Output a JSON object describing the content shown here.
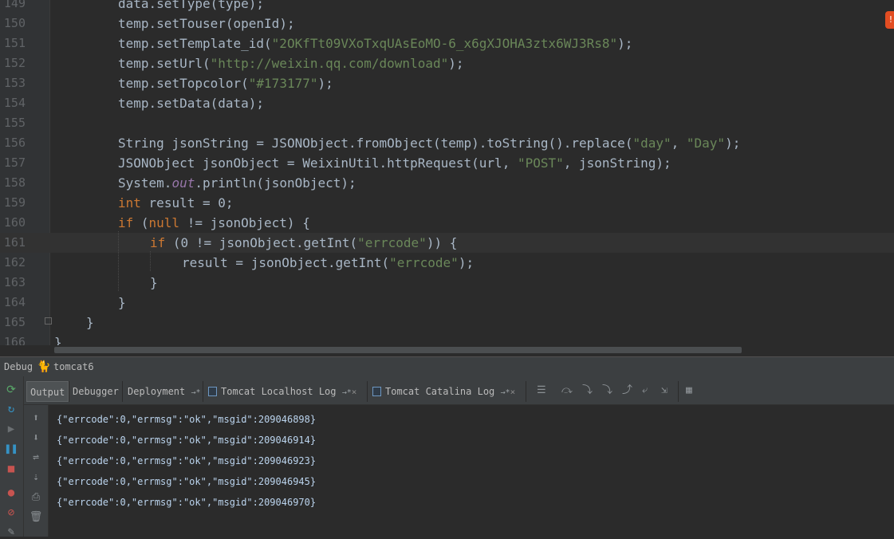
{
  "editor": {
    "lines": [
      {
        "num": "149",
        "indent": 2,
        "tokens": [
          [
            "v",
            "data"
          ],
          [
            "p",
            "."
          ],
          [
            "m",
            "setType"
          ],
          [
            "p",
            "("
          ],
          [
            "v",
            "type"
          ],
          [
            "p",
            ");"
          ]
        ]
      },
      {
        "num": "150",
        "indent": 2,
        "tokens": [
          [
            "v",
            "temp"
          ],
          [
            "p",
            "."
          ],
          [
            "m",
            "setTouser"
          ],
          [
            "p",
            "("
          ],
          [
            "v",
            "openId"
          ],
          [
            "p",
            ");"
          ]
        ]
      },
      {
        "num": "151",
        "indent": 2,
        "tokens": [
          [
            "v",
            "temp"
          ],
          [
            "p",
            "."
          ],
          [
            "m",
            "setTemplate_id"
          ],
          [
            "p",
            "("
          ],
          [
            "s",
            "\"2OKfTt09VXoTxqUAsEoMO-6_x6gXJOHA3ztx6WJ3Rs8\""
          ],
          [
            "p",
            ");"
          ]
        ]
      },
      {
        "num": "152",
        "indent": 2,
        "tokens": [
          [
            "v",
            "temp"
          ],
          [
            "p",
            "."
          ],
          [
            "m",
            "setUrl"
          ],
          [
            "p",
            "("
          ],
          [
            "s",
            "\"http://weixin.qq.com/download\""
          ],
          [
            "p",
            ");"
          ]
        ]
      },
      {
        "num": "153",
        "indent": 2,
        "tokens": [
          [
            "v",
            "temp"
          ],
          [
            "p",
            "."
          ],
          [
            "m",
            "setTopcolor"
          ],
          [
            "p",
            "("
          ],
          [
            "s",
            "\"#173177\""
          ],
          [
            "p",
            ");"
          ]
        ]
      },
      {
        "num": "154",
        "indent": 2,
        "tokens": [
          [
            "v",
            "temp"
          ],
          [
            "p",
            "."
          ],
          [
            "m",
            "setData"
          ],
          [
            "p",
            "("
          ],
          [
            "v",
            "data"
          ],
          [
            "p",
            ");"
          ]
        ]
      },
      {
        "num": "155",
        "indent": 2,
        "tokens": []
      },
      {
        "num": "156",
        "indent": 2,
        "tokens": [
          [
            "t",
            "String"
          ],
          [
            "p",
            " "
          ],
          [
            "v",
            "jsonString"
          ],
          [
            "p",
            " = "
          ],
          [
            "t",
            "JSONObject"
          ],
          [
            "p",
            "."
          ],
          [
            "m",
            "fromObject"
          ],
          [
            "p",
            "("
          ],
          [
            "v",
            "temp"
          ],
          [
            "p",
            ")."
          ],
          [
            "m",
            "toString"
          ],
          [
            "p",
            "()."
          ],
          [
            "m",
            "replace"
          ],
          [
            "p",
            "("
          ],
          [
            "s",
            "\"day\""
          ],
          [
            "p",
            ", "
          ],
          [
            "s",
            "\"Day\""
          ],
          [
            "p",
            ");"
          ]
        ]
      },
      {
        "num": "157",
        "indent": 2,
        "tokens": [
          [
            "t",
            "JSONObject"
          ],
          [
            "p",
            " "
          ],
          [
            "v",
            "jsonObject"
          ],
          [
            "p",
            " = "
          ],
          [
            "t",
            "WeixinUtil"
          ],
          [
            "p",
            "."
          ],
          [
            "m",
            "httpRequest"
          ],
          [
            "p",
            "("
          ],
          [
            "v",
            "url"
          ],
          [
            "p",
            ", "
          ],
          [
            "s",
            "\"POST\""
          ],
          [
            "p",
            ", "
          ],
          [
            "v",
            "jsonString"
          ],
          [
            "p",
            ");"
          ]
        ]
      },
      {
        "num": "158",
        "indent": 2,
        "tokens": [
          [
            "t",
            "System"
          ],
          [
            "p",
            "."
          ],
          [
            "f",
            "out"
          ],
          [
            "p",
            "."
          ],
          [
            "m",
            "println"
          ],
          [
            "p",
            "("
          ],
          [
            "v",
            "jsonObject"
          ],
          [
            "p",
            ");"
          ]
        ]
      },
      {
        "num": "159",
        "indent": 2,
        "tokens": [
          [
            "k",
            "int"
          ],
          [
            "p",
            " "
          ],
          [
            "v",
            "result"
          ],
          [
            "p",
            " = "
          ],
          [
            "n",
            "0"
          ],
          [
            "p",
            ";"
          ]
        ]
      },
      {
        "num": "160",
        "indent": 2,
        "tokens": [
          [
            "k",
            "if"
          ],
          [
            "p",
            " ("
          ],
          [
            "k",
            "null"
          ],
          [
            "p",
            " != "
          ],
          [
            "v",
            "jsonObject"
          ],
          [
            "p",
            ") {"
          ]
        ]
      },
      {
        "num": "161",
        "indent": 3,
        "tokens": [
          [
            "k",
            "if"
          ],
          [
            "p",
            " ("
          ],
          [
            "n",
            "0"
          ],
          [
            "p",
            " != "
          ],
          [
            "v",
            "jsonObject"
          ],
          [
            "p",
            "."
          ],
          [
            "m",
            "getInt"
          ],
          [
            "p",
            "("
          ],
          [
            "s",
            "\"errcode\""
          ],
          [
            "p",
            ")) {"
          ]
        ]
      },
      {
        "num": "162",
        "indent": 4,
        "tokens": [
          [
            "v",
            "result"
          ],
          [
            "p",
            " = "
          ],
          [
            "v",
            "jsonObject"
          ],
          [
            "p",
            "."
          ],
          [
            "m",
            "getInt"
          ],
          [
            "p",
            "("
          ],
          [
            "s",
            "\"errcode\""
          ],
          [
            "p",
            ");"
          ]
        ]
      },
      {
        "num": "163",
        "indent": 3,
        "tokens": [
          [
            "p",
            "}"
          ]
        ]
      },
      {
        "num": "164",
        "indent": 2,
        "tokens": [
          [
            "p",
            "}"
          ]
        ]
      },
      {
        "num": "165",
        "indent": 1,
        "tokens": [
          [
            "p",
            "}"
          ]
        ]
      },
      {
        "num": "166",
        "indent": 0,
        "tokens": [
          [
            "p",
            "}"
          ]
        ]
      }
    ],
    "current_line": "161"
  },
  "debug": {
    "title": "Debug",
    "config": "tomcat6"
  },
  "tabs": [
    {
      "label": "Output",
      "selected": true
    },
    {
      "label": "Debugger",
      "selected": false
    },
    {
      "label": "Deployment",
      "pin": "→*",
      "selected": false
    },
    {
      "label": "Tomcat Localhost Log",
      "pin": "→*",
      "close": "×",
      "selected": false
    },
    {
      "label": "Tomcat Catalina Log",
      "pin": "→*",
      "close": "×",
      "selected": false
    }
  ],
  "console": {
    "lines": [
      "{\"errcode\":0,\"errmsg\":\"ok\",\"msgid\":209046898}",
      "{\"errcode\":0,\"errmsg\":\"ok\",\"msgid\":209046914}",
      "{\"errcode\":0,\"errmsg\":\"ok\",\"msgid\":209046923}",
      "{\"errcode\":0,\"errmsg\":\"ok\",\"msgid\":209046945}",
      "{\"errcode\":0,\"errmsg\":\"ok\",\"msgid\":209046970}"
    ]
  },
  "icons": {
    "left_toolbar": [
      "rerun-icon",
      "refresh-icon",
      "resume-icon",
      "pause-icon",
      "stop-icon",
      "view-breakpoints-icon",
      "mute-breakpoints-icon",
      "unknown-icon"
    ],
    "inner_toolbar": [
      "up-arrow-icon",
      "down-arrow-icon",
      "soft-wrap-icon",
      "scroll-to-end-icon",
      "print-icon",
      "trash-icon"
    ]
  },
  "colors": {
    "keyword": "#cc7832",
    "string": "#6a8759",
    "field": "#9876aa",
    "default": "#a9b7c6",
    "console_text": "#bbd4ee"
  }
}
